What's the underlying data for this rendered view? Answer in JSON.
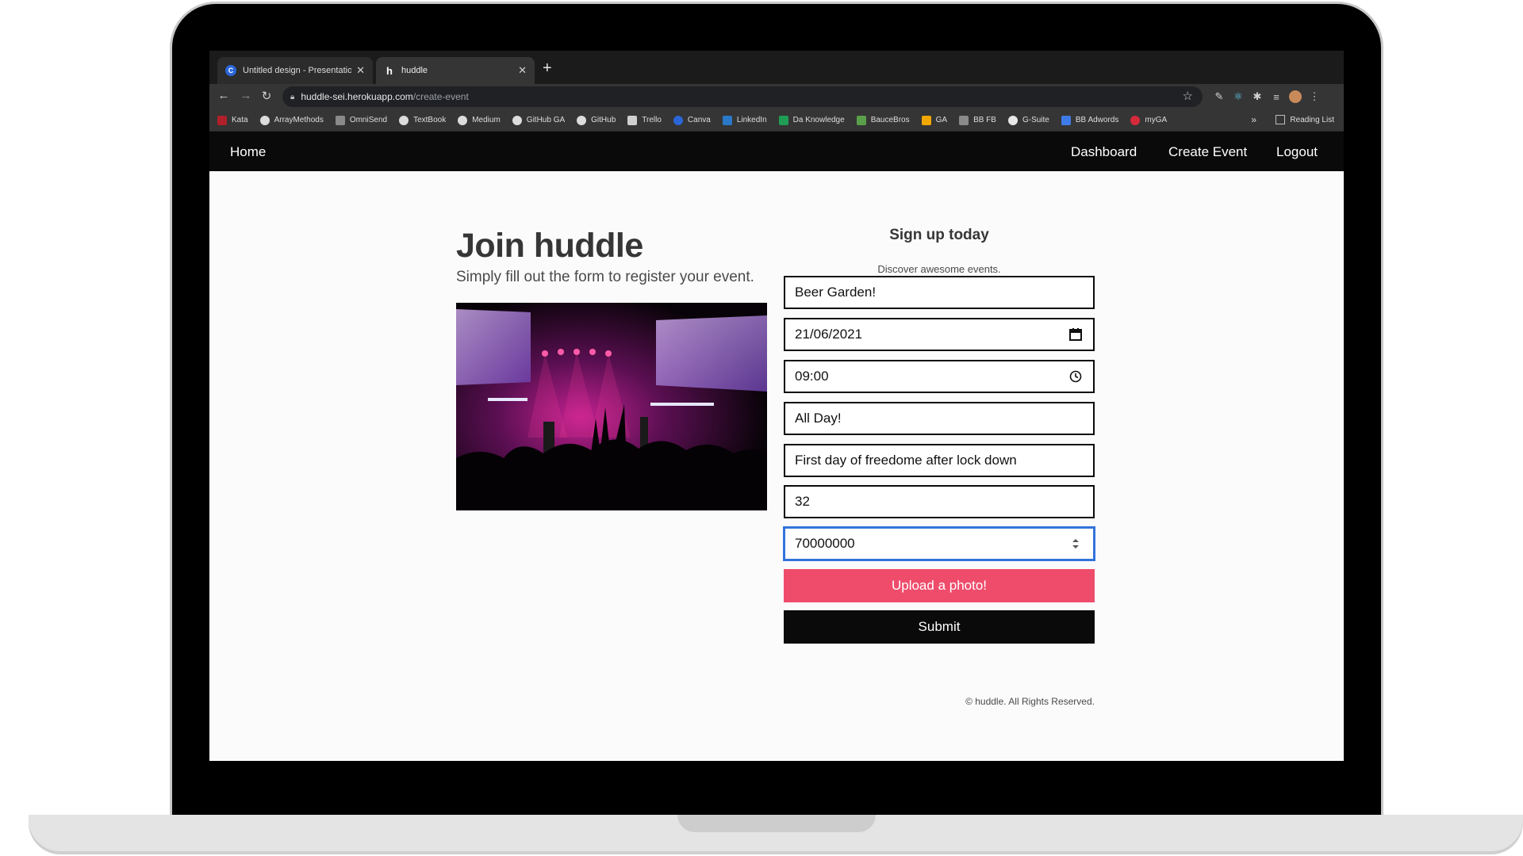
{
  "browser": {
    "tabs": [
      {
        "title": "Untitled design - Presentation",
        "favicon": "C",
        "favicon_color": "#2a66d8"
      },
      {
        "title": "huddle",
        "favicon": "h",
        "favicon_color": "#353535"
      }
    ],
    "url_host": "huddle-sei.herokuapp.com",
    "url_path": "/create-event",
    "bookmarks": [
      {
        "label": "Kata",
        "color": "#b0202a"
      },
      {
        "label": "ArrayMethods",
        "color": "#dcdcdc"
      },
      {
        "label": "OmniSend",
        "color": "#8a8a8a"
      },
      {
        "label": "TextBook",
        "color": "#dcdcdc"
      },
      {
        "label": "Medium",
        "color": "#dcdcdc"
      },
      {
        "label": "GitHub GA",
        "color": "#dcdcdc"
      },
      {
        "label": "GitHub",
        "color": "#dcdcdc"
      },
      {
        "label": "Trello",
        "color": "#cfcfcf"
      },
      {
        "label": "Canva",
        "color": "#2a66d8"
      },
      {
        "label": "LinkedIn",
        "color": "#2a78c8"
      },
      {
        "label": "Da Knowledge",
        "color": "#1f9d55"
      },
      {
        "label": "BauceBros",
        "color": "#5aa04a"
      },
      {
        "label": "GA",
        "color": "#f2a600"
      },
      {
        "label": "BB FB",
        "color": "#8a8a8a"
      },
      {
        "label": "G-Suite",
        "color": "#e8e8e8"
      },
      {
        "label": "BB Adwords",
        "color": "#3f7be8"
      },
      {
        "label": "myGA",
        "color": "#d62a3a"
      }
    ],
    "bookmarks_more": "»",
    "reading_list": "Reading List"
  },
  "nav": {
    "home": "Home",
    "dashboard": "Dashboard",
    "create_event": "Create Event",
    "logout": "Logout"
  },
  "hero": {
    "title": "Join huddle",
    "subtitle": "Simply fill out the form to register your event."
  },
  "form": {
    "title": "Sign up today",
    "subtitle": "Discover awesome events.",
    "fields": [
      {
        "value": "Beer Garden!"
      },
      {
        "value": "21/06/2021",
        "icon": "calendar-icon"
      },
      {
        "value": "09:00",
        "icon": "clock-icon"
      },
      {
        "value": "All Day!"
      },
      {
        "value": "First day of freedome after lock down"
      },
      {
        "value": "32"
      },
      {
        "value": "70000000",
        "icon": "spinner-icon"
      }
    ],
    "upload_label": "Upload a photo!",
    "submit_label": "Submit"
  },
  "footer": {
    "copyright": "© huddle. All Rights Reserved."
  },
  "colors": {
    "upload_button": "#ef4c6c",
    "navbar": "#0a0a0a",
    "focus": "#3273dc"
  }
}
